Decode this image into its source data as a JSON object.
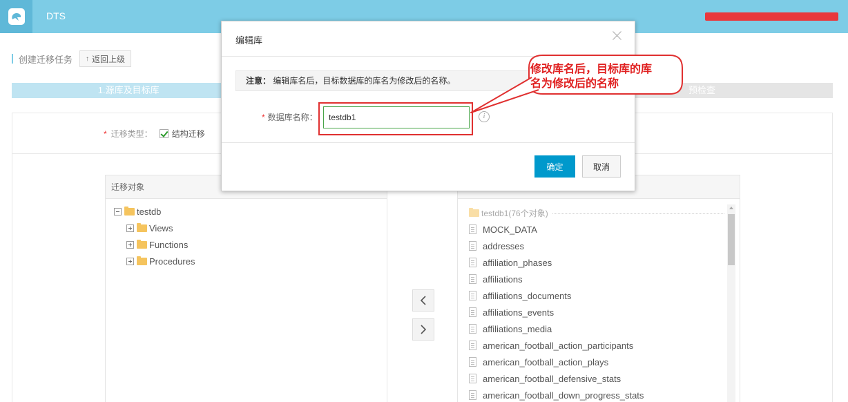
{
  "topbar": {
    "app_name": "DTS"
  },
  "page": {
    "title": "创建迁移任务",
    "back_label": "返回上级"
  },
  "steps": [
    {
      "label": "1.源库及目标库"
    },
    {
      "label": "预检查"
    }
  ],
  "migration_type": {
    "label": "迁移类型：",
    "option": "结构迁移"
  },
  "left_panel": {
    "header": "迁移对象",
    "root": "testdb",
    "children": [
      "Views",
      "Functions",
      "Procedures"
    ]
  },
  "right_panel": {
    "root": "testdb1(76个对象)",
    "items": [
      "MOCK_DATA",
      "addresses",
      "affiliation_phases",
      "affiliations",
      "affiliations_documents",
      "affiliations_events",
      "affiliations_media",
      "american_football_action_participants",
      "american_football_action_plays",
      "american_football_defensive_stats",
      "american_football_down_progress_stats"
    ]
  },
  "modal": {
    "title": "编辑库",
    "notice_bold": "注意：",
    "notice_text": "编辑库名后，目标数据库的库名为修改后的名称。",
    "field_label": "数据库名称：",
    "field_value": "testdb1",
    "ok_label": "确定",
    "cancel_label": "取消"
  },
  "annotation": {
    "line1": "修改库名后，目标库的库",
    "line2": "名为修改后的名称"
  },
  "colors": {
    "topbar": "#7dcce6",
    "primary": "#0099cc",
    "annotation": "#e02020"
  }
}
